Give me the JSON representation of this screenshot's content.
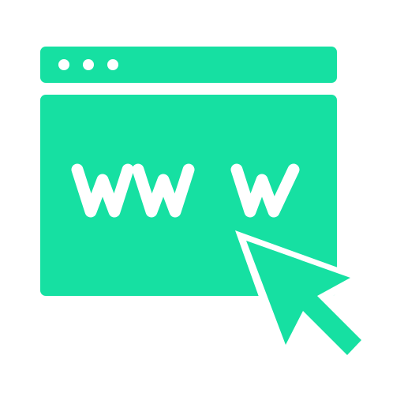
{
  "icon": {
    "name": "web-browser-www-icon",
    "accent_color": "#16e0a2",
    "background_color": "#ffffff",
    "address_text": "WWW",
    "window_dots": 3
  }
}
